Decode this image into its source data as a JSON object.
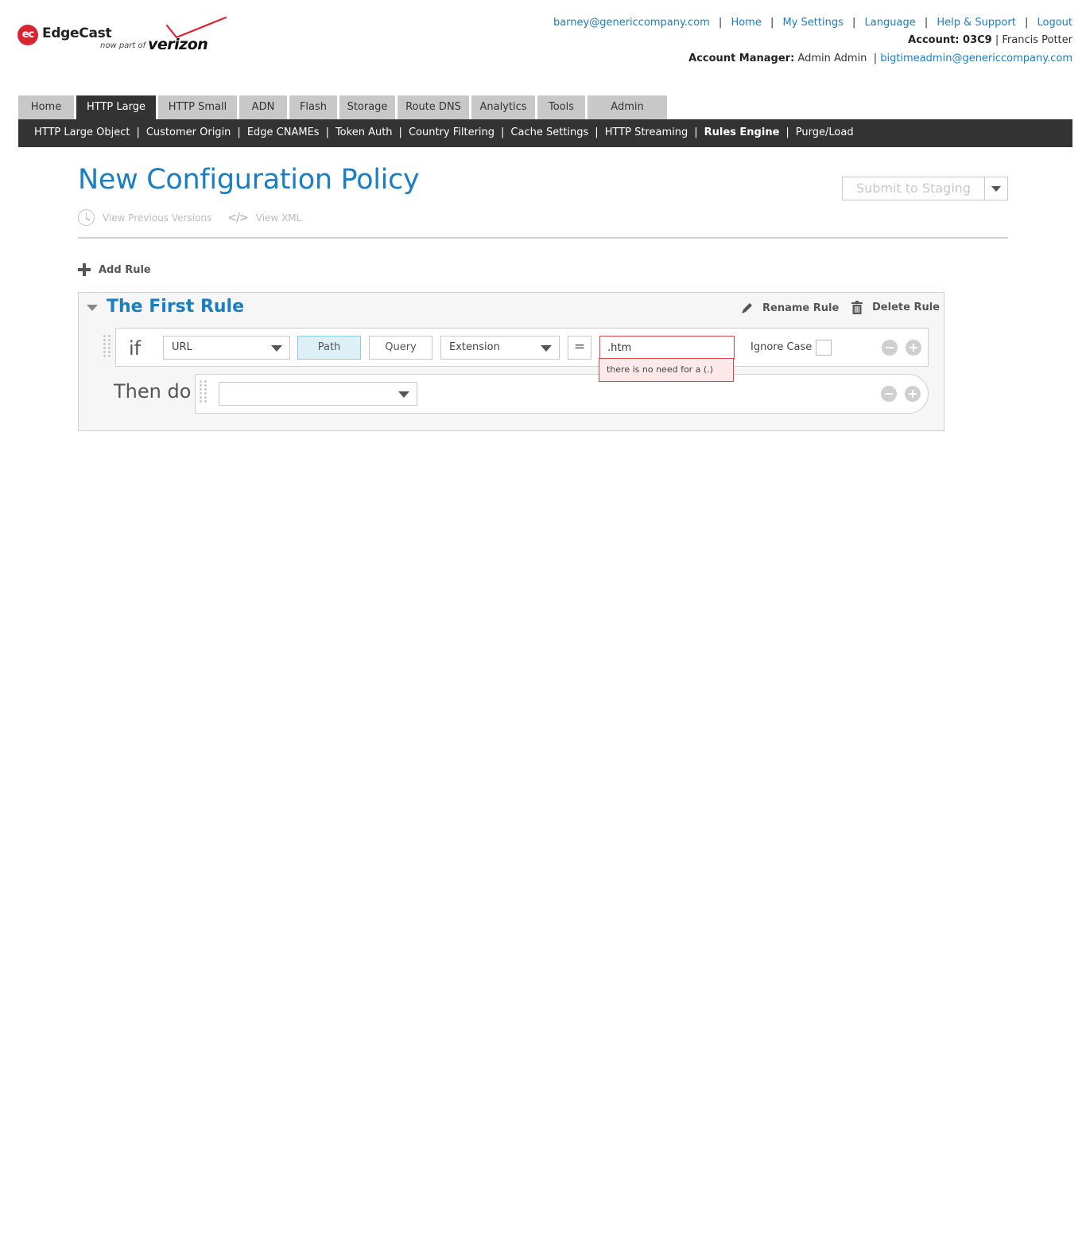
{
  "brand": {
    "logo_mark": "ec",
    "name": "EdgeCast",
    "tagline": "now part of",
    "partner": "verizon",
    "accent_red": "#d9232f"
  },
  "colors": {
    "link_blue": "#1a7ec3",
    "nav_dark": "#333333",
    "tab_gray": "#c8c8c8",
    "error_red": "#d9464c",
    "error_bg": "#fde9e9",
    "active_seg_bg": "#dcf0f6"
  },
  "top_links": {
    "user_email": "barney@genericcompany.com",
    "home": "Home",
    "my_settings": "My Settings",
    "language": "Language",
    "help": "Help & Support",
    "logout": "Logout",
    "separator": "|"
  },
  "account": {
    "label": "Account: 03C9",
    "name": "Francis Potter",
    "manager_label": "Account Manager:",
    "manager_name": "Admin Admin",
    "manager_email": "bigtimeadmin@genericcompany.com"
  },
  "tabs": [
    {
      "label": "Home",
      "active": false
    },
    {
      "label": "HTTP Large",
      "active": true
    },
    {
      "label": "HTTP Small",
      "active": false
    },
    {
      "label": "ADN",
      "active": false
    },
    {
      "label": "Flash",
      "active": false
    },
    {
      "label": "Storage",
      "active": false
    },
    {
      "label": "Route DNS",
      "active": false
    },
    {
      "label": "Analytics",
      "active": false
    },
    {
      "label": "Tools",
      "active": false
    },
    {
      "label": "Admin",
      "active": false
    }
  ],
  "subnav": [
    {
      "label": "HTTP Large Object",
      "active": false
    },
    {
      "label": "Customer Origin",
      "active": false
    },
    {
      "label": "Edge CNAMEs",
      "active": false
    },
    {
      "label": "Token Auth",
      "active": false
    },
    {
      "label": "Country Filtering",
      "active": false
    },
    {
      "label": "Cache Settings",
      "active": false
    },
    {
      "label": "HTTP Streaming",
      "active": false
    },
    {
      "label": "Rules Engine",
      "active": true
    },
    {
      "label": "Purge/Load",
      "active": false
    }
  ],
  "page": {
    "title": "New Configuration Policy",
    "submit_label": "Submit to Staging",
    "view_previous": "View Previous Versions",
    "xml_icon_glyph": "</>",
    "view_xml": "View XML",
    "add_rule": "Add Rule"
  },
  "rule": {
    "title": "The First Rule",
    "rename": "Rename Rule",
    "delete": "Delete Rule",
    "if_label": "if",
    "condition": {
      "match_type": "URL",
      "path_btn": "Path",
      "query_btn": "Query",
      "path_active": true,
      "attribute": "Extension",
      "operator": "=",
      "value": ".htm",
      "error": "there is no need for a (.)",
      "ignore_case_label": "Ignore Case",
      "ignore_case_checked": false
    },
    "then_label": "Then do",
    "action": {
      "selected": ""
    }
  }
}
